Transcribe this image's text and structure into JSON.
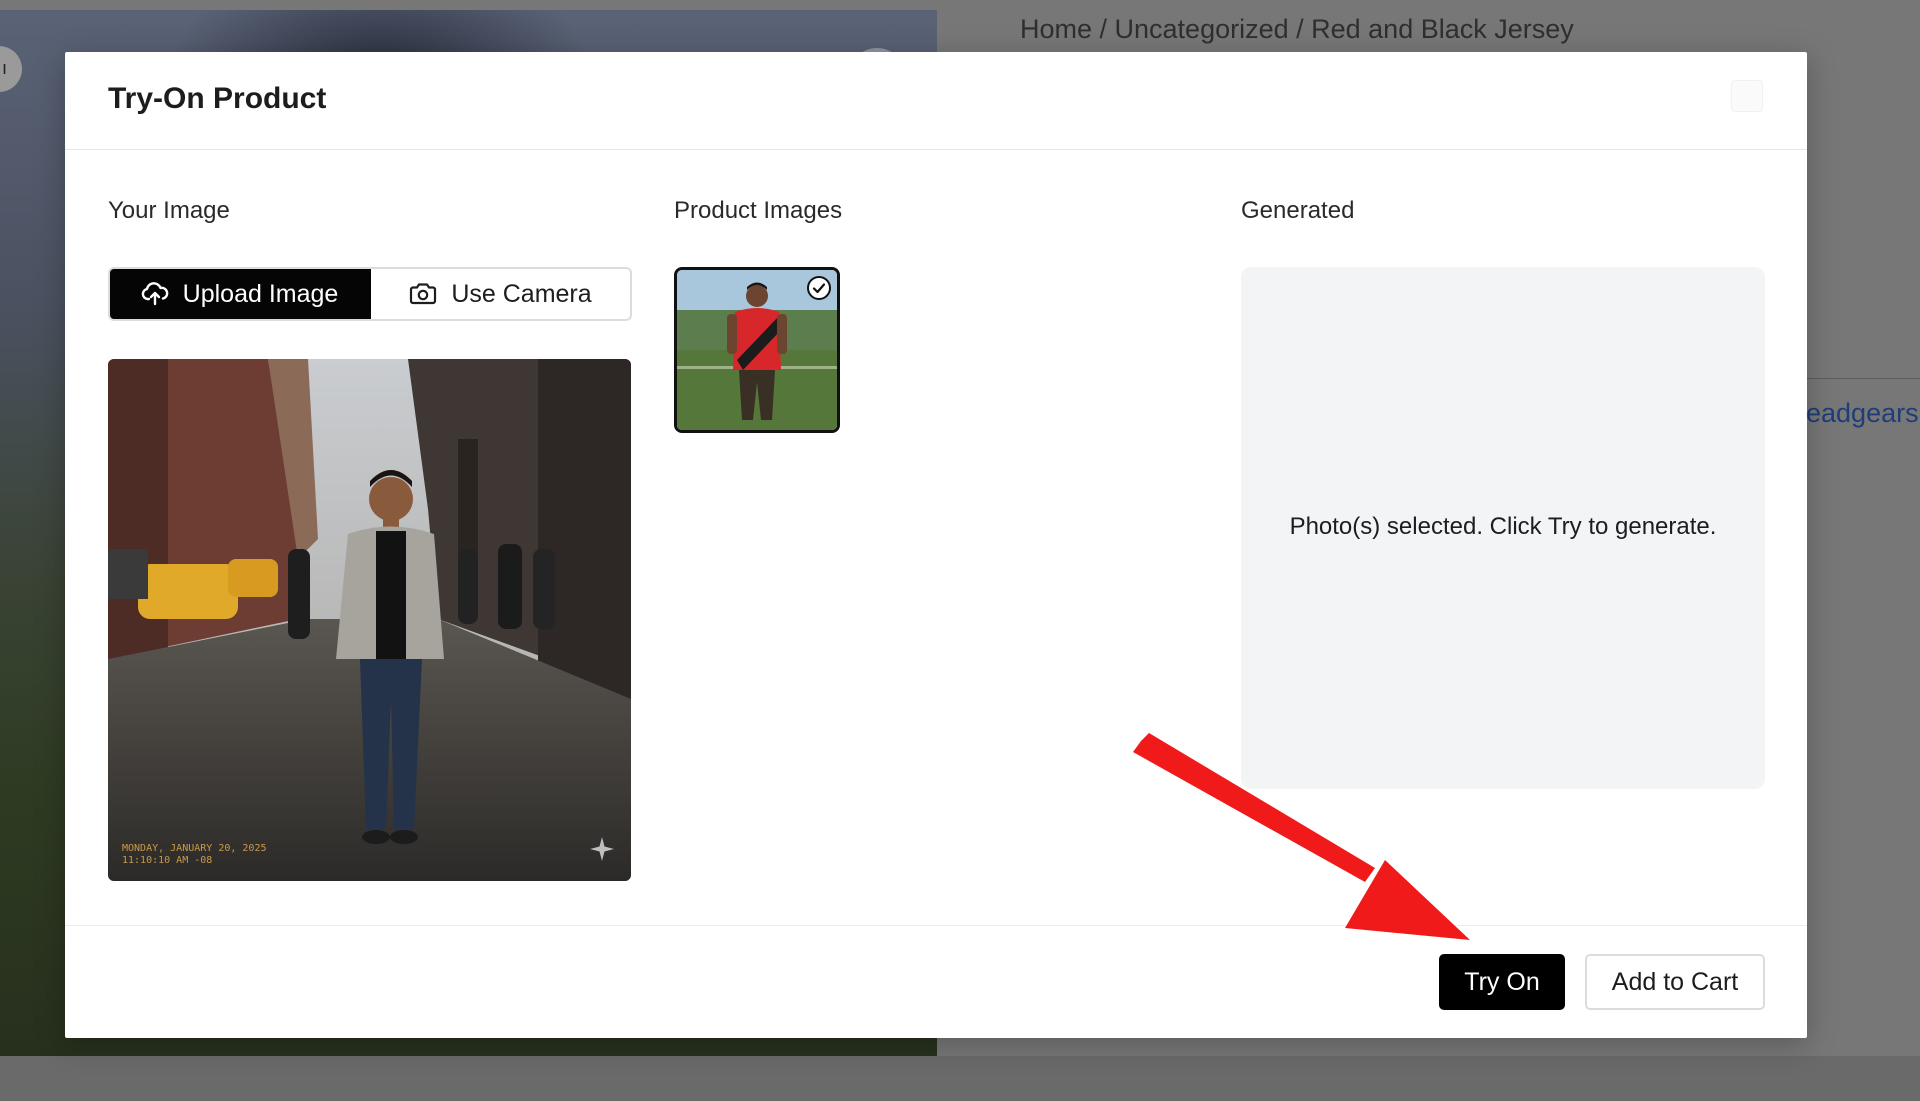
{
  "background_page": {
    "breadcrumb": "Home / Uncategorized / Red and Black Jersey",
    "side_link": "eadgears",
    "left_tab_glyph": "ı"
  },
  "modal": {
    "title": "Try-On Product",
    "your_image": {
      "label": "Your Image",
      "upload_button": "Upload Image",
      "camera_button": "Use Camera",
      "photo_stamp_line1": "MONDAY, JANUARY 20, 2025",
      "photo_stamp_line2": "11:10:10 AM  -08"
    },
    "product_images": {
      "label": "Product Images",
      "selected": true
    },
    "generated": {
      "label": "Generated",
      "message": "Photo(s) selected. Click Try to generate."
    },
    "footer": {
      "try_on_button": "Try On",
      "add_to_cart_button": "Add to Cart"
    }
  },
  "colors": {
    "primary_button": "#000000",
    "annotation_arrow": "#f01a1a",
    "generated_panel_bg": "#f3f4f6"
  },
  "icons": {
    "upload": "cloud-upload-icon",
    "camera": "camera-icon",
    "selected": "check-circle-icon",
    "annotation": "red-arrow-icon"
  }
}
